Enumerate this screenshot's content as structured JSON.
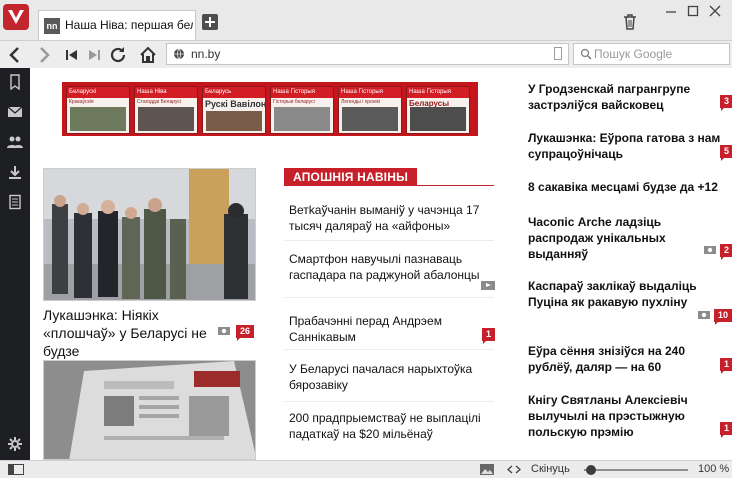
{
  "browser": {
    "tab_title": "Наша Ніва: першая беларуская",
    "tab_favicon": "nn",
    "url": "nn.by",
    "search_placeholder": "Пошук Google",
    "zoom_label": "Скінуць",
    "zoom_value": "100 %",
    "zoom_level_percent": 100,
    "accent": "#c2252c"
  },
  "banner": {
    "magazines": [
      {
        "head": "Беларускі",
        "sub": "Кракаўскія"
      },
      {
        "head": "Наша Ніва",
        "sub": "Cтагоддзі Беларусі"
      },
      {
        "head": "Беларусь",
        "sub": "Рускі Вавілон"
      },
      {
        "head": "Наша Гісторыя",
        "sub": "Гісторыя беларусі"
      },
      {
        "head": "Наша Гісторыя",
        "sub": "Легенды і хронікі"
      },
      {
        "head": "Наша Гісторыя",
        "sub": "Беларусы"
      }
    ]
  },
  "lead": {
    "headline": "Лукашэнка: Ніякіх «плошчаў» у Беларусі не будзе",
    "count": "26"
  },
  "latest": {
    "title": "АПОШНІЯ НАВІНЫ",
    "items": [
      {
        "text": "Ветkаўчанін выманіў у чачэнца 17 тысяч даляраў на «айфоны»"
      },
      {
        "text": "Смартфон навучылі пазнаваць гаспадара па раджуной абалонцы"
      },
      {
        "text": "Прабачэнні перад Андрэем Саннікавым",
        "count": "1"
      },
      {
        "text": "У Беларусі пачалася нарыхтоўка бярозавіку"
      },
      {
        "text": "200 прадпрыемстваў не выплацілі падаткаў на $20 мільёнаў"
      }
    ]
  },
  "right": {
    "items": [
      {
        "text": "У Гродзенскай пагрангрупе застрэліўся вайсковец",
        "count": "3"
      },
      {
        "text": "Лукашэнка: Еўропа гатова з нам супрацоўнічаць",
        "count": "5"
      },
      {
        "text": "8 сакавіка месцамі будзе да +12"
      },
      {
        "text": "Часопіс Arche ладзіць распродаж унікальных выданняў",
        "count": "2"
      },
      {
        "text": "Каспараў заклікаў выдаліць Пуціна як ракавую пухліну",
        "count": "10"
      },
      {
        "text": "Еўра сёння знізіўся на 240 рублёў, даляр — на 60",
        "count": "1"
      },
      {
        "text": "Кнігу Святланы Алексіевіч вылучылі на прэстыжную польскую прэмію",
        "count": "1"
      }
    ]
  }
}
